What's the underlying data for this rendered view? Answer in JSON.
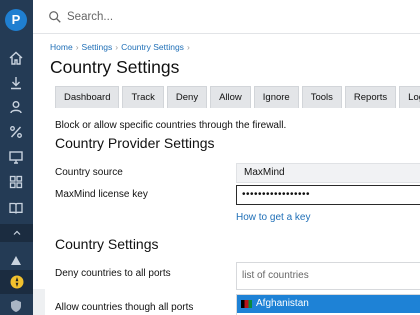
{
  "app": {
    "logo_letter": "P"
  },
  "search": {
    "placeholder": "Search..."
  },
  "breadcrumb": [
    "Home",
    "Settings",
    "Country Settings"
  ],
  "page_title": "Country Settings",
  "tabs": [
    "Dashboard",
    "Track",
    "Deny",
    "Allow",
    "Ignore",
    "Tools",
    "Reports",
    "Logs"
  ],
  "description": "Block or allow specific countries through the firewall.",
  "provider_section": {
    "title": "Country Provider Settings",
    "source_label": "Country source",
    "source_value": "MaxMind",
    "license_label": "MaxMind license key",
    "license_value": "•••••••••••••••••",
    "help_link": "How to get a key"
  },
  "country_section": {
    "title": "Country Settings",
    "deny_label": "Deny countries to all ports",
    "deny_placeholder": "list of countries",
    "allow_label": "Allow countries though all ports",
    "option_selected": "Afghanistan"
  },
  "colors": {
    "sidebar": "#243b55",
    "accent": "#1e82d6",
    "link": "#1f6fb7"
  },
  "sidebar_icons": [
    "home-icon",
    "download-icon",
    "user-icon",
    "percent-icon",
    "monitor-icon",
    "grid-icon",
    "book-icon",
    "up-chevron-icon",
    "hazard-icon",
    "shield-icon"
  ]
}
